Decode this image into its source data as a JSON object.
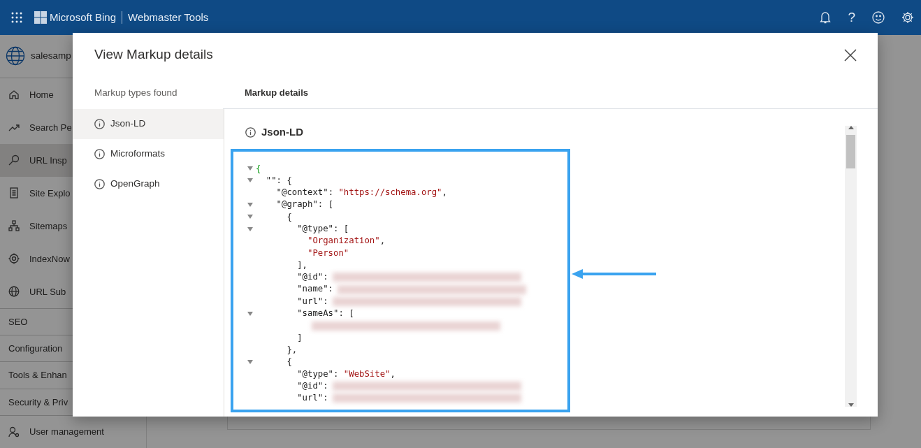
{
  "header": {
    "brand": "Microsoft Bing",
    "product": "Webmaster Tools",
    "help_glyph": "?"
  },
  "sidebar": {
    "site": "salesamp",
    "items": [
      {
        "label": "Home",
        "kind": "nav",
        "selected": false
      },
      {
        "label": "Search Pe",
        "kind": "nav",
        "selected": false
      },
      {
        "label": "URL Insp",
        "kind": "nav",
        "selected": true
      },
      {
        "label": "Site Explo",
        "kind": "nav",
        "selected": false
      },
      {
        "label": "Sitemaps",
        "kind": "nav",
        "selected": false
      },
      {
        "label": "IndexNow",
        "kind": "nav",
        "selected": false
      },
      {
        "label": "URL Sub",
        "kind": "nav",
        "selected": false
      },
      {
        "label": "SEO",
        "kind": "section",
        "selected": false
      },
      {
        "label": "Configuration",
        "kind": "section",
        "selected": false
      },
      {
        "label": "Tools & Enhan",
        "kind": "section",
        "selected": false
      },
      {
        "label": "Security & Priv",
        "kind": "section",
        "selected": false
      },
      {
        "label": "User management",
        "kind": "nav",
        "selected": false
      }
    ]
  },
  "modal": {
    "title": "View Markup details",
    "types_heading": "Markup types found",
    "types": [
      {
        "label": "Json-LD",
        "selected": true
      },
      {
        "label": "Microformats",
        "selected": false
      },
      {
        "label": "OpenGraph",
        "selected": false
      }
    ],
    "details_heading": "Markup details",
    "details_title": "Json-LD",
    "code": [
      {
        "expanded": true,
        "parts": [
          {
            "kind": "root",
            "text": "{"
          }
        ],
        "children": [
          {
            "expanded": true,
            "parts": [
              {
                "kind": "punct",
                "text": "\"\": {"
              }
            ],
            "children": [
              {
                "parts": [
                  {
                    "kind": "punct",
                    "text": "\"@context\": "
                  },
                  {
                    "kind": "string",
                    "text": "\"https://schema.org\""
                  },
                  {
                    "kind": "punct",
                    "text": ","
                  }
                ]
              },
              {
                "expanded": true,
                "parts": [
                  {
                    "kind": "punct",
                    "text": "\"@graph\": ["
                  }
                ],
                "children": [
                  {
                    "expanded": true,
                    "parts": [
                      {
                        "kind": "punct",
                        "text": "{"
                      }
                    ],
                    "children": [
                      {
                        "expanded": true,
                        "parts": [
                          {
                            "kind": "punct",
                            "text": "\"@type\": ["
                          }
                        ],
                        "children": [
                          {
                            "parts": [
                              {
                                "kind": "string",
                                "text": "\"Organization\""
                              },
                              {
                                "kind": "punct",
                                "text": ","
                              }
                            ]
                          },
                          {
                            "parts": [
                              {
                                "kind": "string",
                                "text": "\"Person\""
                              }
                            ]
                          }
                        ]
                      },
                      {
                        "parts": [
                          {
                            "kind": "punct",
                            "text": "],"
                          }
                        ]
                      },
                      {
                        "parts": [
                          {
                            "kind": "punct",
                            "text": "\"@id\":"
                          }
                        ],
                        "redacted": true
                      },
                      {
                        "parts": [
                          {
                            "kind": "punct",
                            "text": "\"name\":"
                          }
                        ],
                        "redacted": true
                      },
                      {
                        "parts": [
                          {
                            "kind": "punct",
                            "text": "\"url\":"
                          }
                        ],
                        "redacted": true
                      },
                      {
                        "expanded": true,
                        "parts": [
                          {
                            "kind": "punct",
                            "text": "\"sameAs\": ["
                          }
                        ],
                        "children": [
                          {
                            "redacted": true
                          }
                        ]
                      },
                      {
                        "parts": [
                          {
                            "kind": "punct",
                            "text": "]"
                          }
                        ]
                      }
                    ]
                  },
                  {
                    "parts": [
                      {
                        "kind": "punct",
                        "text": "},"
                      }
                    ]
                  },
                  {
                    "expanded": true,
                    "parts": [
                      {
                        "kind": "punct",
                        "text": "{"
                      }
                    ],
                    "children": [
                      {
                        "parts": [
                          {
                            "kind": "punct",
                            "text": "\"@type\": "
                          },
                          {
                            "kind": "string",
                            "text": "\"WebSite\""
                          },
                          {
                            "kind": "punct",
                            "text": ","
                          }
                        ]
                      },
                      {
                        "parts": [
                          {
                            "kind": "punct",
                            "text": "\"@id\":"
                          }
                        ],
                        "redacted": true
                      },
                      {
                        "parts": [
                          {
                            "kind": "punct",
                            "text": "\"url\":"
                          }
                        ],
                        "redacted": true
                      }
                    ]
                  }
                ]
              }
            ]
          }
        ]
      }
    ]
  }
}
